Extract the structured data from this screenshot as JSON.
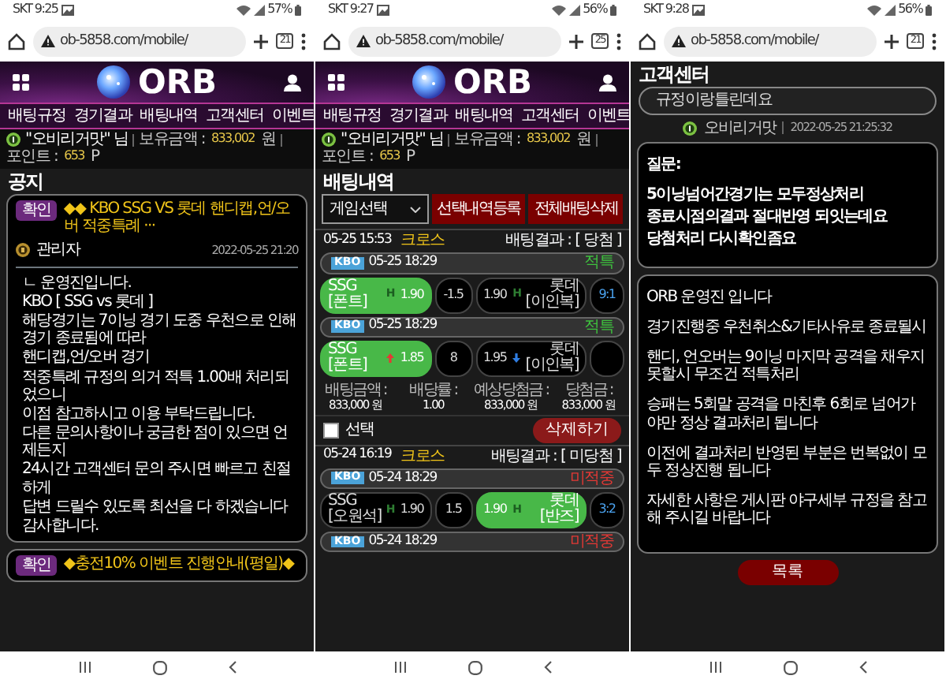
{
  "screens": [
    {
      "kind": "notice",
      "status_bar": {
        "time": "SKT 9:25",
        "battery": "57%"
      },
      "browser": {
        "url": "ob-5858.com/mobile/",
        "tab_count": "21"
      },
      "site": {
        "logo": "ORB",
        "menu": [
          "배팅규정",
          "경기결과",
          "배팅내역",
          "고객센터",
          "이벤트"
        ],
        "user": "\"오비리거맛\" 님",
        "balance": {
          "label": "보유금액 :",
          "value": "833,002",
          "unit": "원"
        },
        "points": {
          "label": "포인트 :",
          "value": "653",
          "unit": "P"
        }
      },
      "title": "공지",
      "posts": [
        {
          "badge": "확인",
          "title": "◆◆ KBO SSG VS 롯데 핸디캡,언/오버 적중특례 ···",
          "author": "관리자",
          "date": "2022-05-25 21:20",
          "body": [
            "ㄴ 운영진입니다.",
            "KBO [ SSG vs 롯데 ]",
            "해당경기는 7이닝 경기 도중 우천으로 인해 경기 종료됨에 따라",
            "핸디캡,언/오버 경기",
            "적중특례 규정의 의거 적특 1.00배 처리되었으니",
            "이점 참고하시고 이용 부탁드립니다.",
            "다른 문의사항이나 궁금한 점이 있으면 언제든지",
            "24시간 고객센터 문의 주시면 빠르고 친절하게",
            "답변 드릴수 있도록 최선을 다 하겠습니다",
            "감사합니다."
          ]
        },
        {
          "badge": "확인",
          "title": "◆충전10% 이벤트 진행안내(평일)◆"
        }
      ]
    },
    {
      "kind": "betting",
      "status_bar": {
        "time": "SKT 9:27",
        "battery": "56%"
      },
      "browser": {
        "url": "ob-5858.com/mobile/",
        "tab_count": "25"
      },
      "site": {
        "logo": "ORB",
        "menu": [
          "배팅규정",
          "경기결과",
          "배팅내역",
          "고객센터",
          "이벤트"
        ],
        "user": "\"오비리거맛\" 님",
        "balance": {
          "label": "보유금액 :",
          "value": "833,002",
          "unit": "원"
        },
        "points": {
          "label": "포인트 :",
          "value": "653",
          "unit": "P"
        }
      },
      "title": "배팅내역",
      "filter": {
        "select": "게임선택",
        "buttons": [
          "선택내역등록",
          "전체배팅삭제"
        ]
      },
      "slips": [
        {
          "time": "05-25 15:53",
          "type": "크로스",
          "result": "배팅결과 : [ 당첨 ]",
          "games": [
            {
              "league": "KBO",
              "time": "05-25 18:29",
              "status": "적특",
              "won": true,
              "home": {
                "team": "SSG [폰트]",
                "odds": "1.90",
                "tag": "H",
                "selected": true
              },
              "line": "-1.5",
              "away": {
                "team": "롯데 [이인복]",
                "odds": "1.90",
                "tag": "H",
                "selected": false
              },
              "score": "9:1"
            },
            {
              "league": "KBO",
              "time": "05-25 18:29",
              "status": "적특",
              "won": true,
              "home": {
                "kind": "over",
                "team": "SSG [폰트]",
                "odds": "1.85",
                "selected": true
              },
              "line": "8",
              "away": {
                "kind": "under",
                "team": "롯데 [이인복]",
                "odds": "1.95",
                "selected": false
              }
            }
          ],
          "summary": [
            {
              "label": "배팅금액 :",
              "value": "833,000 원"
            },
            {
              "label": "배당률 :",
              "value": "1.00"
            },
            {
              "label": "예상당첨금 :",
              "value": "833,000 원"
            },
            {
              "label": "당첨금 :",
              "value": "833,000 원"
            }
          ],
          "select": {
            "label": "선택",
            "checked": false
          },
          "delete": "삭제하기"
        },
        {
          "time": "05-24 16:19",
          "type": "크로스",
          "result": "배팅결과 : [ 미당첨 ]",
          "games": [
            {
              "league": "KBO",
              "time": "05-24 18:29",
              "status": "미적중",
              "won": false,
              "home": {
                "team": "SSG [오원석]",
                "odds": "1.90",
                "tag": "H",
                "selected": false
              },
              "line": "1.5",
              "away": {
                "team": "롯데 [반즈]",
                "odds": "1.90",
                "tag": "H",
                "selected": true
              },
              "score": "3:2"
            },
            {
              "league": "KBO",
              "time": "05-24 18:29",
              "status": "미적중",
              "won": false
            }
          ]
        }
      ]
    },
    {
      "kind": "support",
      "status_bar": {
        "time": "SKT 9:28",
        "battery": "56%"
      },
      "browser": {
        "url": "ob-5858.com/mobile/",
        "tab_count": "21"
      },
      "title": "고객센터",
      "subject": "규정이랑틀린데요",
      "author": "오비리거맛",
      "date": "2022-05-25 21:25:32",
      "question": {
        "label": "질문:",
        "lines": [
          "5이닝넘어간경기는 모두정상처리",
          "종료시점의결과 절대반영 되잇는데요",
          "당첨처리 다시확인좀요"
        ]
      },
      "answer": [
        "ORB 운영진 입니다",
        "경기진행중 우천취소&기타사유로 종료될시",
        "핸디, 언오버는 9이닝 마지막 공격을 채우지 못할시 무조건 적특처리",
        "승패는 5회말 공격을 마친후 6회로 넘어가야만 정상 결과처리 됩니다",
        "이전에 결과처리 반영된 부분은 번복없이 모두 정상진행 됩니다",
        "자세한 사항은 게시판 야구세부 규정을 참고해 주시길 바랍니다"
      ],
      "back_button": "목록"
    }
  ]
}
